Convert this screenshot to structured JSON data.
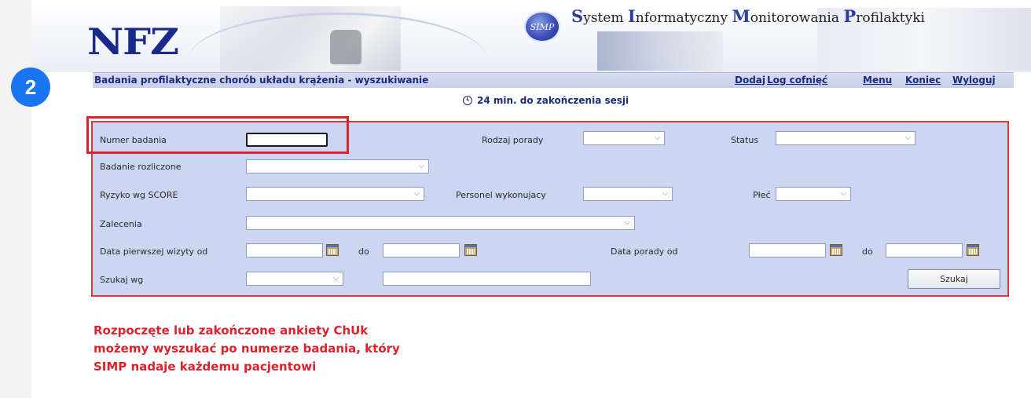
{
  "header": {
    "logo_text": "NFZ",
    "simp_badge": "SIMP",
    "app_title_parts": [
      {
        "text": "S",
        "big": true
      },
      {
        "text": "ystem ",
        "big": false
      },
      {
        "text": "I",
        "big": true
      },
      {
        "text": "nformatyczny ",
        "big": false
      },
      {
        "text": "M",
        "big": true
      },
      {
        "text": "onitorowania ",
        "big": false
      },
      {
        "text": "P",
        "big": true
      },
      {
        "text": "rofilaktyki",
        "big": false
      }
    ]
  },
  "step_badge": "2",
  "nav": {
    "page_title": "Badania profilaktyczne chorób układu krążenia - wyszukiwanie",
    "links": [
      "Dodaj",
      "Log cofnięć",
      "Menu",
      "Koniec",
      "Wyloguj"
    ]
  },
  "session": {
    "icon": "clock-icon",
    "text": "24 min. do zakończenia sesji"
  },
  "form": {
    "numer_badania": {
      "label": "Numer badania",
      "value": ""
    },
    "rodzaj_porady": {
      "label": "Rodzaj porady",
      "value": ""
    },
    "status": {
      "label": "Status",
      "value": ""
    },
    "badanie_rozliczone": {
      "label": "Badanie rozliczone",
      "value": ""
    },
    "ryzyko_score": {
      "label": "Ryzyko wg SCORE",
      "value": ""
    },
    "personel": {
      "label": "Personel wykonujacy",
      "value": ""
    },
    "plec": {
      "label": "Płeć",
      "value": ""
    },
    "zalecenia": {
      "label": "Zalecenia",
      "value": ""
    },
    "data_wizyty_od": {
      "label": "Data pierwszej wizyty od",
      "value": ""
    },
    "data_wizyty_do": {
      "label": "do",
      "value": ""
    },
    "data_porady_od": {
      "label": "Data porady od",
      "value": ""
    },
    "data_porady_do": {
      "label": "do",
      "value": ""
    },
    "szukaj_wg": {
      "label": "Szukaj wg",
      "value": ""
    },
    "szukaj_text": {
      "value": ""
    },
    "search_button": "Szukaj"
  },
  "annotation": {
    "lines": [
      "Rozpoczęte lub zakończone ankiety ChUk",
      "możemy wyszukać po numerze badania, który",
      "SIMP nadaje każdemu pacjentowi"
    ],
    "color": "#e0212b"
  },
  "colors": {
    "form_bg": "#ccd5f2",
    "nav_text": "#1c2a7a",
    "step_badge": "#1976f0"
  }
}
